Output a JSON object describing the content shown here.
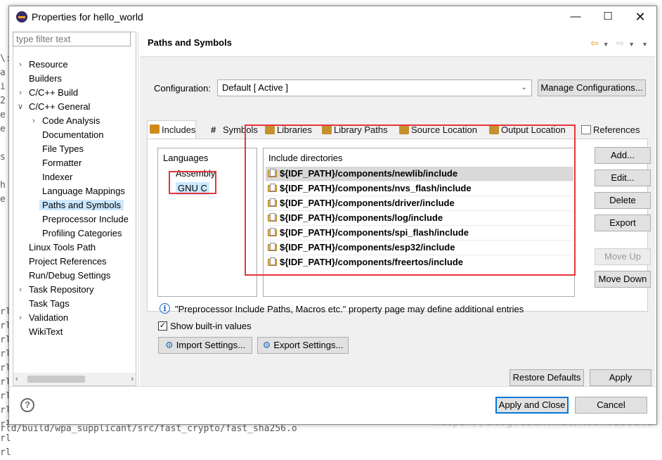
{
  "window": {
    "title": "Properties for hello_world"
  },
  "filter": {
    "placeholder": "type filter text"
  },
  "tree": [
    {
      "label": "Resource",
      "indent": 0,
      "arrow": ">"
    },
    {
      "label": "Builders",
      "indent": 0,
      "arrow": ""
    },
    {
      "label": "C/C++ Build",
      "indent": 0,
      "arrow": ">"
    },
    {
      "label": "C/C++ General",
      "indent": 0,
      "arrow": "v"
    },
    {
      "label": "Code Analysis",
      "indent": 1,
      "arrow": ">"
    },
    {
      "label": "Documentation",
      "indent": 1,
      "arrow": ""
    },
    {
      "label": "File Types",
      "indent": 1,
      "arrow": ""
    },
    {
      "label": "Formatter",
      "indent": 1,
      "arrow": ""
    },
    {
      "label": "Indexer",
      "indent": 1,
      "arrow": ""
    },
    {
      "label": "Language Mappings",
      "indent": 1,
      "arrow": ""
    },
    {
      "label": "Paths and Symbols",
      "indent": 1,
      "arrow": "",
      "selected": true
    },
    {
      "label": "Preprocessor Include",
      "indent": 1,
      "arrow": ""
    },
    {
      "label": "Profiling Categories",
      "indent": 1,
      "arrow": ""
    },
    {
      "label": "Linux Tools Path",
      "indent": 0,
      "arrow": ""
    },
    {
      "label": "Project References",
      "indent": 0,
      "arrow": ""
    },
    {
      "label": "Run/Debug Settings",
      "indent": 0,
      "arrow": ""
    },
    {
      "label": "Task Repository",
      "indent": 0,
      "arrow": ">"
    },
    {
      "label": "Task Tags",
      "indent": 0,
      "arrow": ""
    },
    {
      "label": "Validation",
      "indent": 0,
      "arrow": ">"
    },
    {
      "label": "WikiText",
      "indent": 0,
      "arrow": ""
    }
  ],
  "page": {
    "heading": "Paths and Symbols"
  },
  "config": {
    "label": "Configuration:",
    "value": "Default  [ Active ]",
    "manage_button": "Manage Configurations..."
  },
  "tabs": [
    "Includes",
    "Symbols",
    "Libraries",
    "Library Paths",
    "Source Location",
    "Output Location",
    "References"
  ],
  "languages": {
    "header": "Languages",
    "items": [
      "Assembly",
      "GNU C"
    ],
    "selected": "GNU C"
  },
  "includes": {
    "header": "Include directories",
    "items": [
      "${IDF_PATH}/components/newlib/include",
      "${IDF_PATH}/components/nvs_flash/include",
      "${IDF_PATH}/components/driver/include",
      "${IDF_PATH}/components/log/include",
      "${IDF_PATH}/components/spi_flash/include",
      "${IDF_PATH}/components/esp32/include",
      "${IDF_PATH}/components/freertos/include"
    ]
  },
  "side_buttons": {
    "add": "Add...",
    "edit": "Edit...",
    "delete": "Delete",
    "export": "Export",
    "move_up": "Move Up",
    "move_down": "Move Down"
  },
  "info_text": "\"Preprocessor Include Paths, Macros etc.\" property page may define additional entries",
  "show_builtin": {
    "label": "Show built-in values",
    "checked": true
  },
  "settings": {
    "import": "Import Settings...",
    "export": "Export Settings..."
  },
  "footer": {
    "restore": "Restore Defaults",
    "apply": "Apply",
    "apply_close": "Apply and Close",
    "cancel": "Cancel"
  },
  "background": {
    "left_chars": [
      "\\:",
      "a",
      "i",
      "2",
      "e",
      "e",
      "",
      "s",
      "",
      "h",
      "e"
    ],
    "console_lines": [
      "rl",
      "rl",
      "rl",
      "rl",
      "rl",
      "rl",
      "rl",
      "rl",
      "rl",
      "rl",
      "rl"
    ],
    "bottom_line": "rld/build/wpa_supplicant/src/fast_crypto/fast_sha256.o",
    "watermark": "https://blog.csdn.net/xb870189248"
  }
}
